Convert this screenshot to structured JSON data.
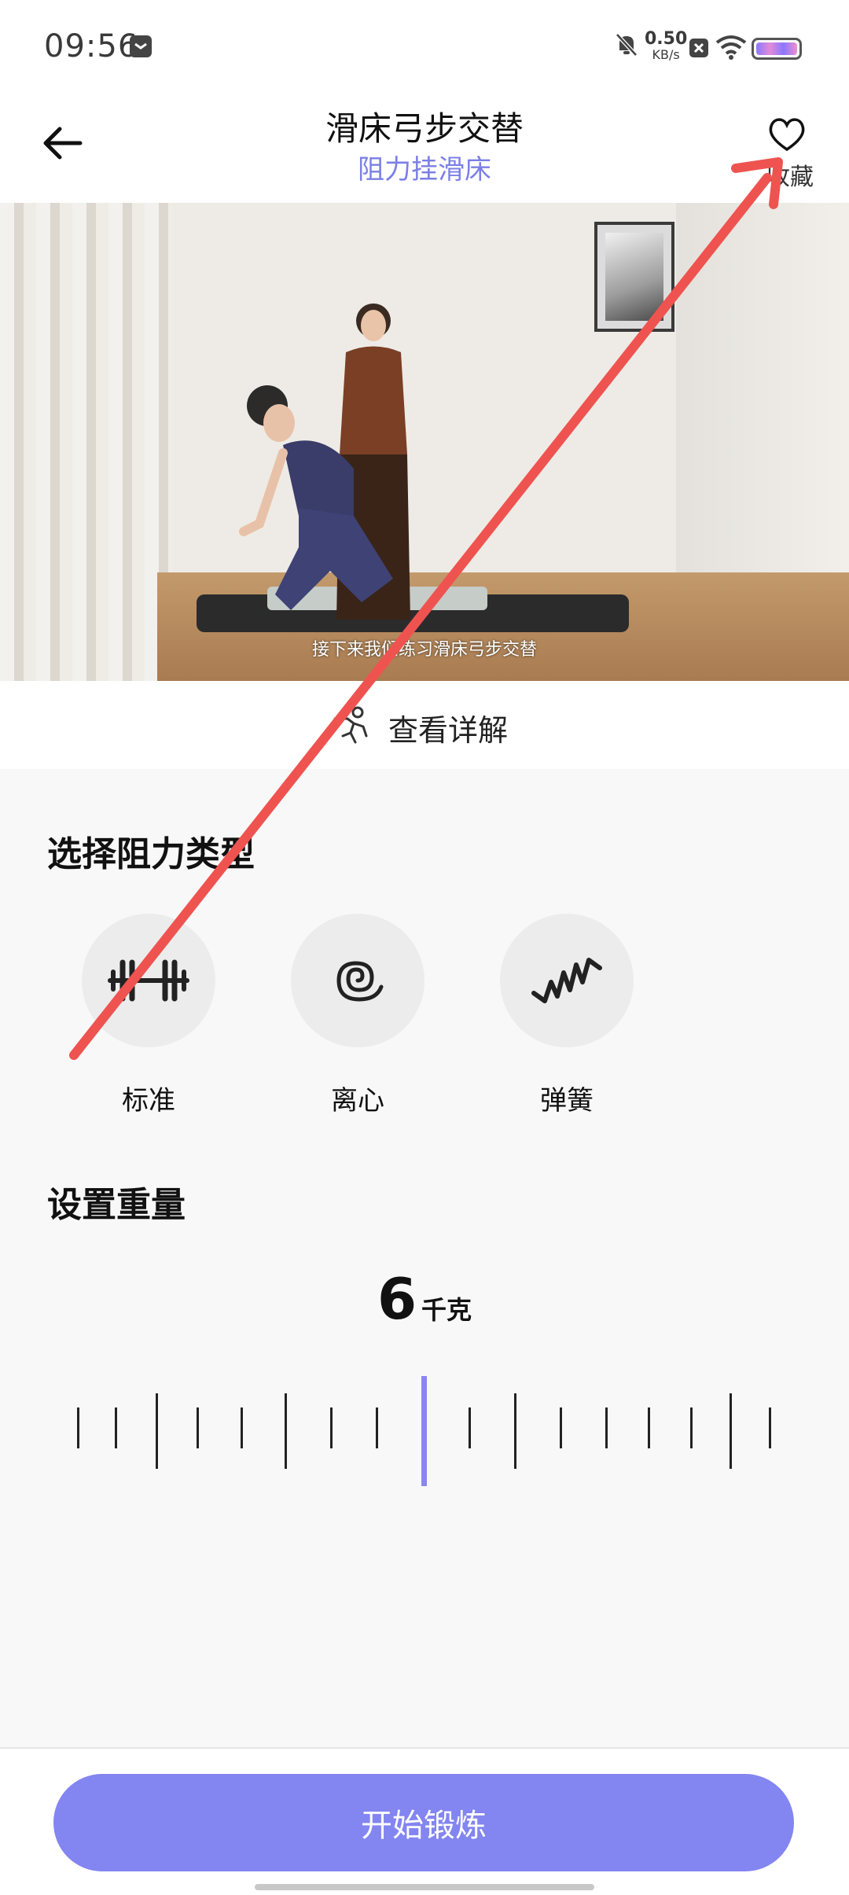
{
  "status_bar": {
    "time": "09:56",
    "net_speed_value": "0.50",
    "net_speed_unit": "KB/s"
  },
  "header": {
    "title": "滑床弓步交替",
    "subtitle": "阻力挂滑床",
    "favorite_label": "收藏"
  },
  "video": {
    "caption": "接下来我们练习滑床弓步交替"
  },
  "detail": {
    "label": "查看详解"
  },
  "resistance": {
    "section_title": "选择阻力类型",
    "options": [
      {
        "label": "标准",
        "icon": "barbell-icon"
      },
      {
        "label": "离心",
        "icon": "spiral-icon"
      },
      {
        "label": "弹簧",
        "icon": "spring-icon"
      }
    ]
  },
  "weight": {
    "section_title": "设置重量",
    "value": "6",
    "unit": "千克"
  },
  "bottom": {
    "start_label": "开始锻炼"
  },
  "colors": {
    "accent": "#8385f0",
    "subtitle": "#7b7fe6",
    "annotation_arrow": "#ef5350"
  }
}
